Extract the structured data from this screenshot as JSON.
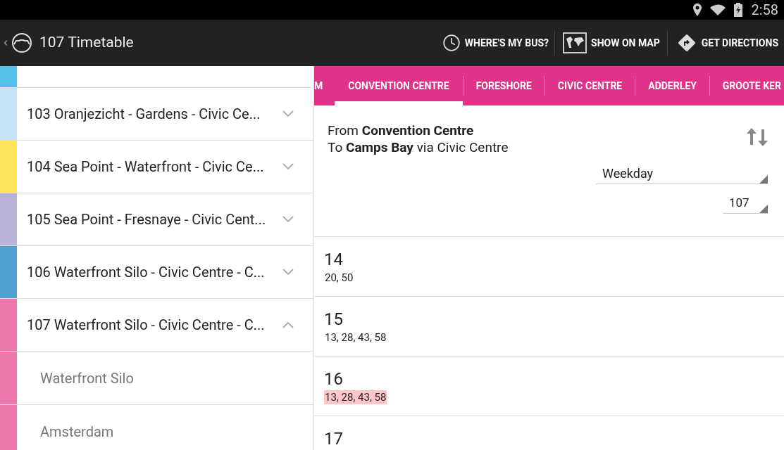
{
  "status_bar": {
    "time": "2:58"
  },
  "action_bar": {
    "title": "107 Timetable",
    "actions": [
      {
        "kind": "clock",
        "label": "WHERE'S MY BUS?"
      },
      {
        "kind": "map",
        "label": "SHOW ON MAP"
      },
      {
        "kind": "directions",
        "label": "GET DIRECTIONS"
      }
    ]
  },
  "routes": [
    {
      "color": "#53c1e9"
    },
    {
      "label": "103 Oranjezicht - Gardens - Civic Ce...",
      "color": "#c6e3f5",
      "expanded": false
    },
    {
      "label": "104 Sea Point - Waterfront - Civic Ce...",
      "color": "#fde45c",
      "expanded": false
    },
    {
      "label": "105 Sea Point - Fresnaye - Civic Cent...",
      "color": "#b8b5d8",
      "expanded": false
    },
    {
      "label": "106 Waterfront Silo - Civic Centre - C...",
      "color": "#4fa0d0",
      "expanded": false
    },
    {
      "label": "107 Waterfront Silo - Civic Centre - C...",
      "color": "#ec78ad",
      "expanded": true,
      "children": [
        {
          "label": "Waterfront Silo"
        },
        {
          "label": "Amsterdam"
        }
      ]
    }
  ],
  "stop_tabs": [
    {
      "label": "M",
      "selected": false
    },
    {
      "label": "CONVENTION CENTRE",
      "selected": true
    },
    {
      "label": "FORESHORE",
      "selected": false
    },
    {
      "label": "CIVIC CENTRE",
      "selected": false
    },
    {
      "label": "ADDERLEY",
      "selected": false
    },
    {
      "label": "GROOTE KER",
      "selected": false
    }
  ],
  "trip": {
    "from": "From **Convention Centre**",
    "to": "To **Camps Bay** via Civic Centre",
    "day": "Weekday",
    "route": "107"
  },
  "hours": [
    {
      "hour": "14",
      "minutes": "20, 50",
      "highlighted": false
    },
    {
      "hour": "15",
      "minutes": "13, 28, 43, 58",
      "highlighted": false
    },
    {
      "hour": "16",
      "minutes": "13, 28, 43, 58",
      "highlighted": true
    },
    {
      "hour": "17"
    }
  ]
}
